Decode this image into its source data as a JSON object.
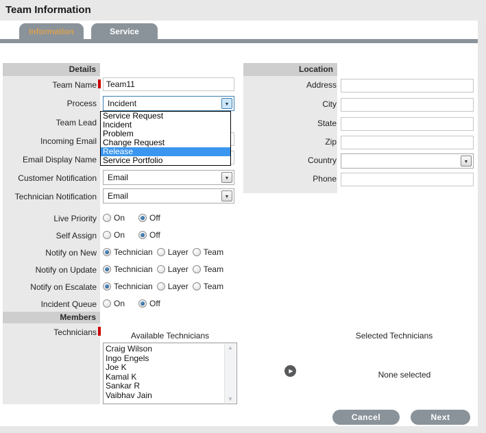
{
  "window": {
    "title": "Team Information"
  },
  "tabs": {
    "information": "Information",
    "service": "Service"
  },
  "colors": {
    "tab_gray": "#8b939a",
    "active_tab_text": "#d7a055",
    "dropdown_highlight": "#3a96ee",
    "required_marker": "#cc0000",
    "section_header_bg": "#cecece",
    "label_column_bg": "#e9e9e9"
  },
  "details": {
    "header": "Details",
    "fields": {
      "team_name": {
        "label": "Team Name",
        "required": true,
        "value": "Team11"
      },
      "process": {
        "label": "Process",
        "value": "Incident",
        "options": [
          "Service Request",
          "Incident",
          "Problem",
          "Change Request",
          "Release",
          "Service Portfolio"
        ],
        "highlighted_option": "Release"
      },
      "team_lead": {
        "label": "Team Lead"
      },
      "incoming_email": {
        "label": "Incoming Email",
        "value": ""
      },
      "email_display_name": {
        "label": "Email Display Name",
        "value": ""
      },
      "customer_notification": {
        "label": "Customer Notification",
        "value": "Email"
      },
      "technician_notification": {
        "label": "Technician Notification",
        "value": "Email"
      },
      "live_priority": {
        "label": "Live Priority",
        "options": [
          "On",
          "Off"
        ],
        "selected": "Off"
      },
      "self_assign": {
        "label": "Self Assign",
        "options": [
          "On",
          "Off"
        ],
        "selected": "Off"
      },
      "notify_on_new": {
        "label": "Notify on New",
        "options": [
          "Technician",
          "Layer",
          "Team"
        ],
        "selected": "Technician"
      },
      "notify_on_update": {
        "label": "Notify on Update",
        "options": [
          "Technician",
          "Layer",
          "Team"
        ],
        "selected": "Technician"
      },
      "notify_on_escalate": {
        "label": "Notify on Escalate",
        "options": [
          "Technician",
          "Layer",
          "Team"
        ],
        "selected": "Technician"
      },
      "incident_queue": {
        "label": "Incident Queue",
        "options": [
          "On",
          "Off"
        ],
        "selected": "Off"
      }
    }
  },
  "location": {
    "header": "Location",
    "fields": {
      "address": {
        "label": "Address",
        "value": ""
      },
      "city": {
        "label": "City",
        "value": ""
      },
      "state": {
        "label": "State",
        "value": ""
      },
      "zip": {
        "label": "Zip",
        "value": ""
      },
      "country": {
        "label": "Country",
        "value": ""
      },
      "phone": {
        "label": "Phone",
        "value": ""
      }
    }
  },
  "members": {
    "header": "Members",
    "technicians_label": "Technicians",
    "technicians_required": true,
    "available_label": "Available Technicians",
    "selected_label": "Selected Technicians",
    "available": [
      "Craig Wilson",
      "Ingo Engels",
      "Joe K",
      "Kamal K",
      "Sankar R",
      "Vaibhav Jain"
    ],
    "selected_empty_text": "None selected"
  },
  "actions": {
    "cancel": "Cancel",
    "next": "Next"
  }
}
